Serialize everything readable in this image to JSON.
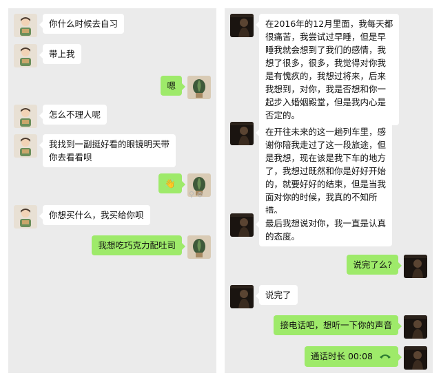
{
  "left": {
    "messages": [
      {
        "dir": "in",
        "avatar": "boy-icon",
        "text": "你什么时候去自习"
      },
      {
        "dir": "in",
        "avatar": "boy-icon",
        "text": "带上我"
      },
      {
        "dir": "out",
        "avatar": "plant-icon",
        "text": "嗯"
      },
      {
        "dir": "in",
        "avatar": "boy-icon",
        "text": "怎么不理人呢"
      },
      {
        "dir": "in",
        "avatar": "boy-icon",
        "text": "我找到一副挺好看的眼镜明天带\n你去看看呗"
      },
      {
        "dir": "out",
        "avatar": "plant-icon",
        "text": "👋"
      },
      {
        "dir": "in",
        "avatar": "boy-icon",
        "text": "你想买什么，我买给你呗"
      },
      {
        "dir": "out",
        "avatar": "plant-icon",
        "text": "我想吃巧克力配吐司"
      }
    ],
    "watermark": "⚲ ⊚"
  },
  "right": {
    "messages": [
      {
        "dir": "in",
        "avatar": "dark-portrait-icon",
        "text": "在2016年的12月里面，我每天都\n很痛苦，我尝试过早睡，但是早\n睡我就会想到了我们的感情，我\n想了很多，很多，我觉得对你我\n是有愧疚的，我想过将来，后来\n我想到，对你，我是否想和你一\n起步入婚姻殿堂，但是我内心是\n否定的。"
      },
      {
        "dir": "in",
        "avatar": "dark-portrait-icon",
        "text": "在开往未来的这一趟列车里，感\n谢你陪我走过了这一段旅途，但\n是我想，现在该是我下车的地方\n了，我想过既然和你是好好开始\n的，就要好好的结束，但是当我\n面对你的时候，我真的不知所\n措。"
      },
      {
        "dir": "in",
        "avatar": "dark-portrait-icon",
        "text": "最后我想说对你，我一直是认真\n的态度。"
      },
      {
        "dir": "out",
        "avatar": "dark-portrait-icon",
        "text": "说完了么?"
      },
      {
        "dir": "in",
        "avatar": "dark-portrait-icon",
        "text": "说完了"
      },
      {
        "dir": "out",
        "avatar": "dark-portrait-icon",
        "text": "接电话吧，想听一下你的声音"
      },
      {
        "dir": "out",
        "avatar": "dark-portrait-icon",
        "text": "通话时长 00:08",
        "call": true
      }
    ]
  },
  "colors": {
    "panel": "#ebebeb",
    "incoming": "#ffffff",
    "outgoing": "#9eea6a"
  }
}
